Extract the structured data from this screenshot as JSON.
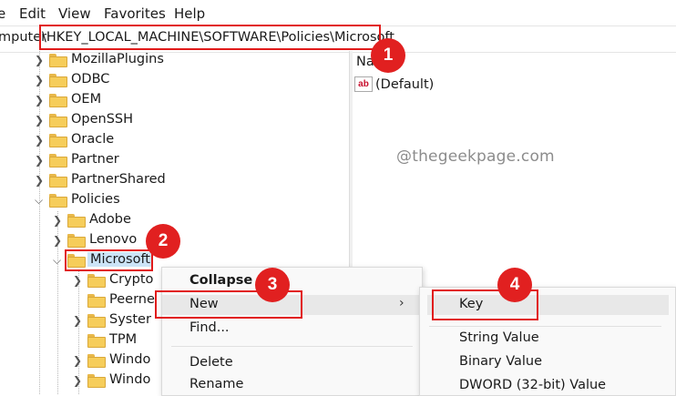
{
  "menubar": {
    "items": [
      "e",
      "Edit",
      "View",
      "Favorites",
      "Help"
    ]
  },
  "address": {
    "prefix": "mputer",
    "path": "\\HKEY_LOCAL_MACHINE\\SOFTWARE\\Policies\\Microsoft"
  },
  "tree": {
    "items": [
      {
        "label": "MozillaPlugins"
      },
      {
        "label": "ODBC"
      },
      {
        "label": "OEM"
      },
      {
        "label": "OpenSSH"
      },
      {
        "label": "Oracle"
      },
      {
        "label": "Partner"
      },
      {
        "label": "PartnerShared"
      },
      {
        "label": "Policies"
      },
      {
        "label": "Adobe"
      },
      {
        "label": "Lenovo"
      },
      {
        "label": "Microsoft"
      },
      {
        "label": "Crypto"
      },
      {
        "label": "Peerne"
      },
      {
        "label": "Syster"
      },
      {
        "label": "TPM"
      },
      {
        "label": "Windo"
      },
      {
        "label": "Windo"
      }
    ]
  },
  "rightpane": {
    "column_header": "Na",
    "value_icon": "ab",
    "value_name": "(Default)"
  },
  "watermark": "@thegeekpage.com",
  "context_menu": {
    "collapse": "Collapse",
    "new": "New",
    "arrow": "›",
    "find": "Find...",
    "delete": "Delete",
    "rename": "Rename"
  },
  "submenu": {
    "key": "Key",
    "string_value": "String Value",
    "binary_value": "Binary Value",
    "dword_value": "DWORD (32-bit) Value"
  },
  "badges": [
    "1",
    "2",
    "3",
    "4"
  ],
  "colors": {
    "annotation_red": "#e11b1b",
    "selection": "#cce4f7",
    "folder": "#f6cd5a"
  }
}
